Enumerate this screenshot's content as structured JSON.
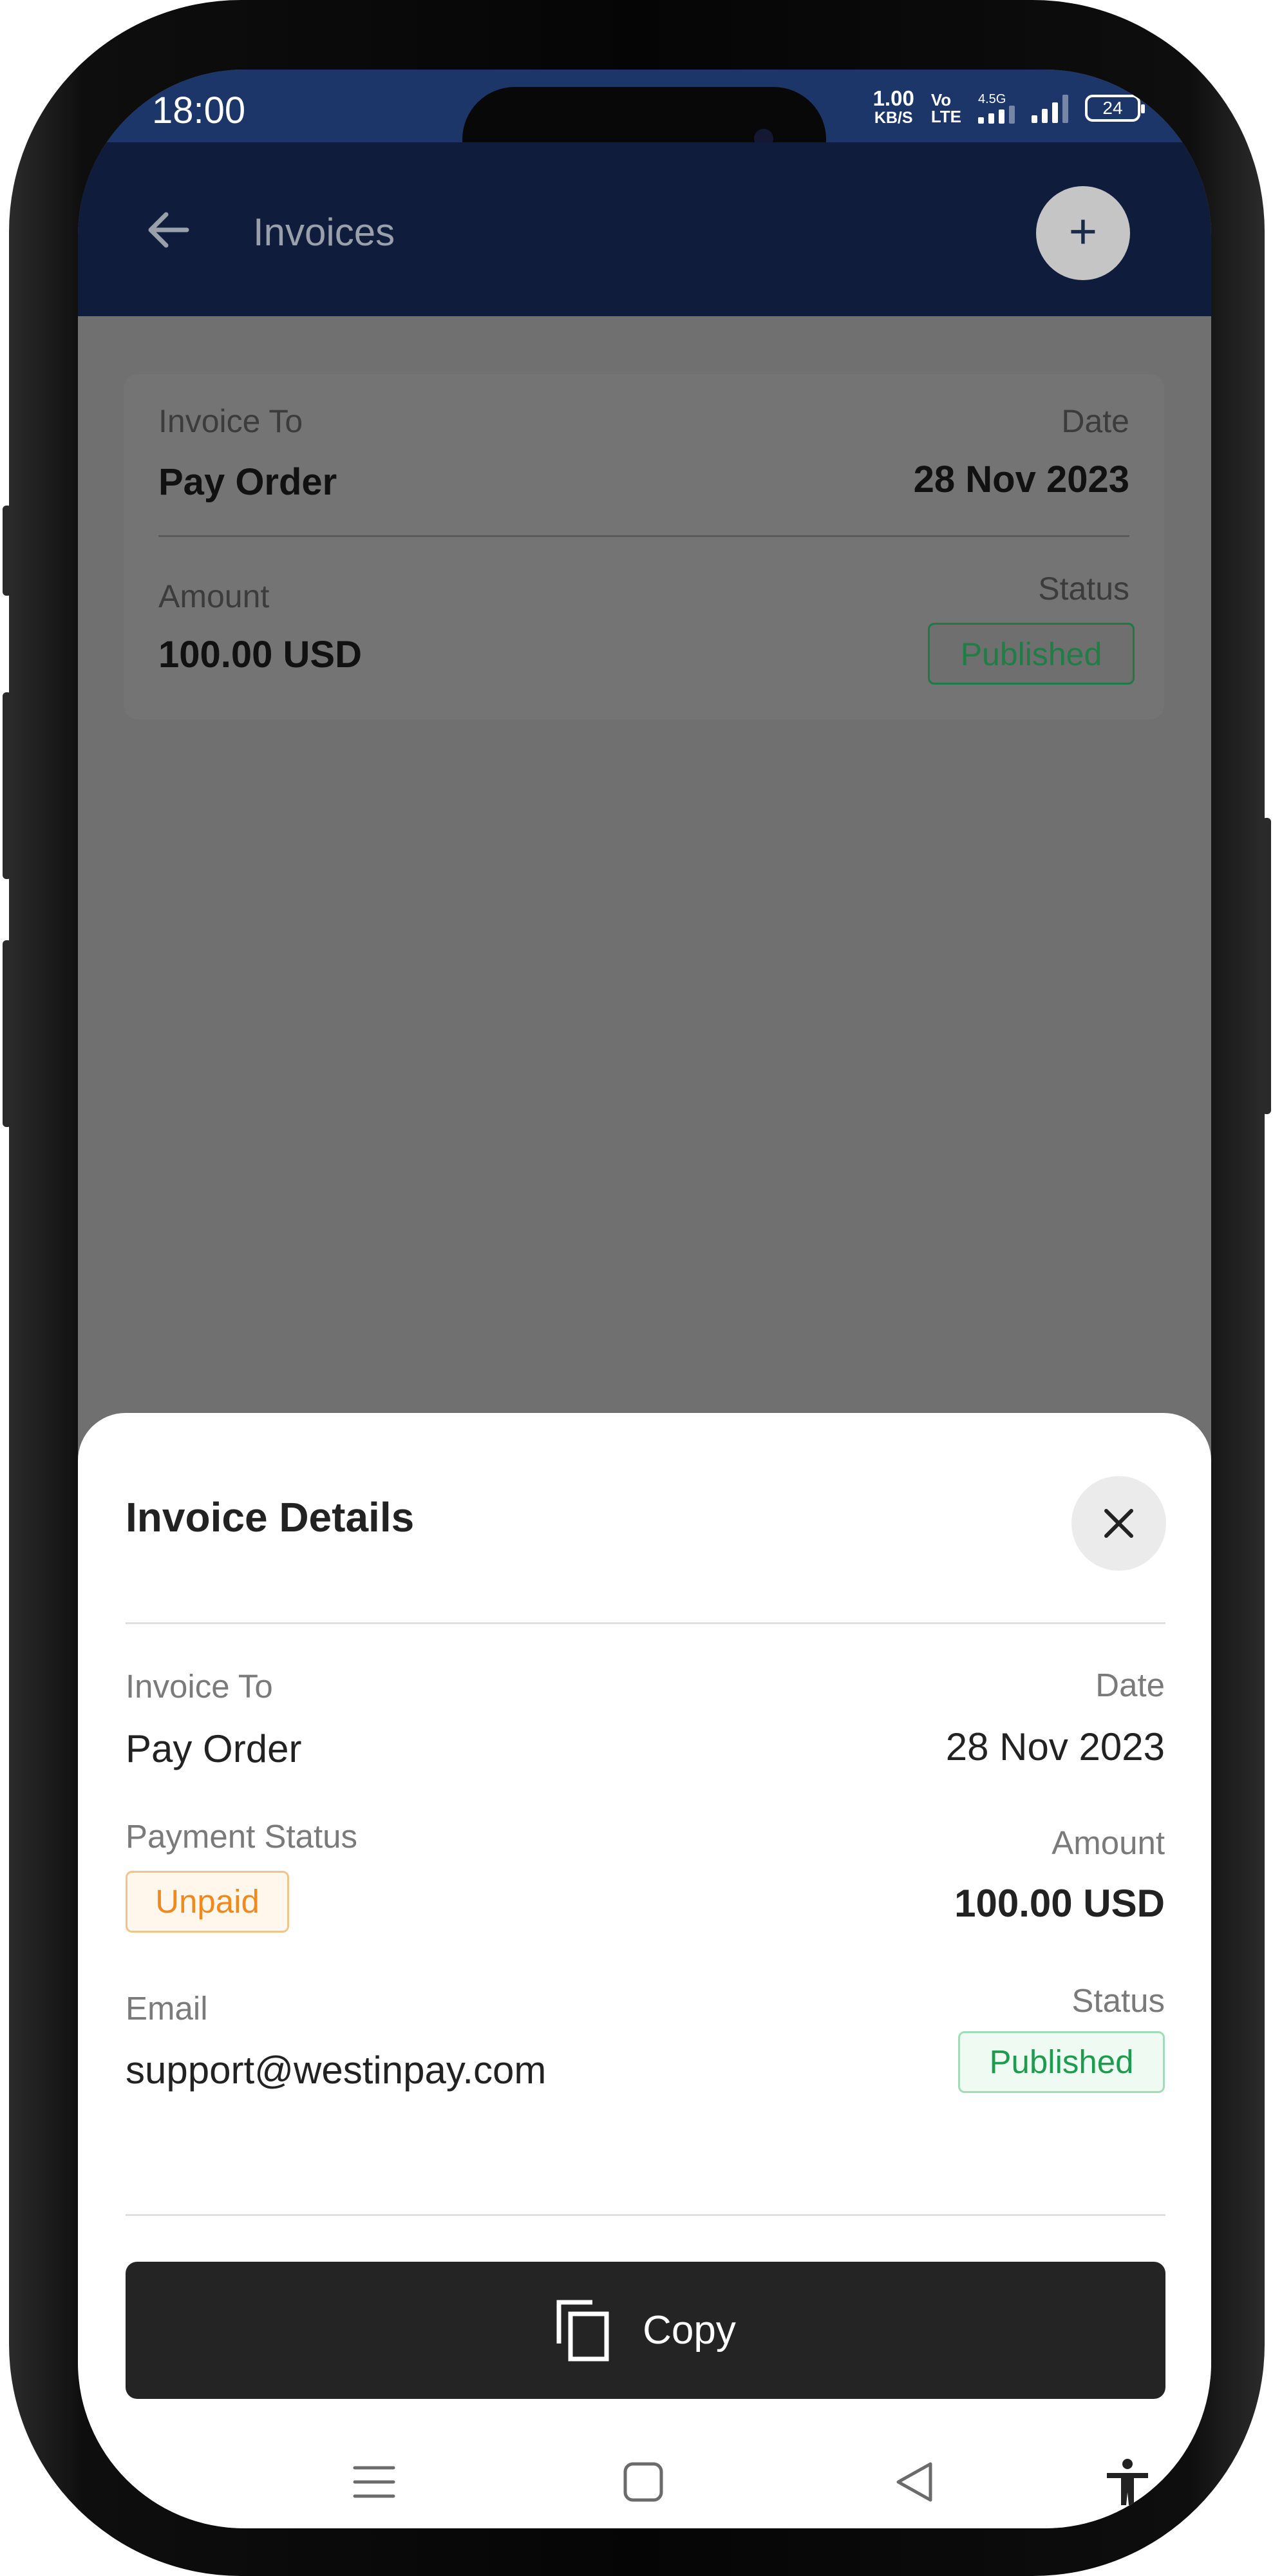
{
  "status_bar": {
    "time": "18:00",
    "net_speed": "1.00",
    "net_unit": "KB/S",
    "volte_top": "Vo",
    "volte_bottom": "LTE",
    "network_type": "4.5G",
    "battery": "24"
  },
  "app_bar": {
    "title": "Invoices",
    "back_icon": "arrow-left-icon",
    "add_icon": "plus-icon"
  },
  "invoice_card": {
    "invoice_to_label": "Invoice To",
    "invoice_to": "Pay Order",
    "date_label": "Date",
    "date": "28 Nov 2023",
    "amount_label": "Amount",
    "amount": "100.00 USD",
    "status_label": "Status",
    "status": "Published"
  },
  "sheet": {
    "title": "Invoice Details",
    "close_icon": "close-icon",
    "invoice_to_label": "Invoice To",
    "invoice_to": "Pay Order",
    "date_label": "Date",
    "date": "28 Nov 2023",
    "payment_status_label": "Payment Status",
    "payment_status": "Unpaid",
    "amount_label": "Amount",
    "amount": "100.00 USD",
    "email_label": "Email",
    "email": "support@westinpay.com",
    "status_label": "Status",
    "status": "Published",
    "copy_label": "Copy",
    "copy_icon": "copy-icon"
  },
  "nav_bar": {
    "items": [
      "menu-icon",
      "home-square-icon",
      "back-triangle-icon",
      "accessibility-icon"
    ]
  },
  "colors": {
    "status_bar": "#1c3669",
    "app_bar": "#0f1c3b",
    "overlay": "#707070",
    "copy_button": "#242424",
    "unpaid": "#f08a1c",
    "published": "#1f9b50"
  }
}
